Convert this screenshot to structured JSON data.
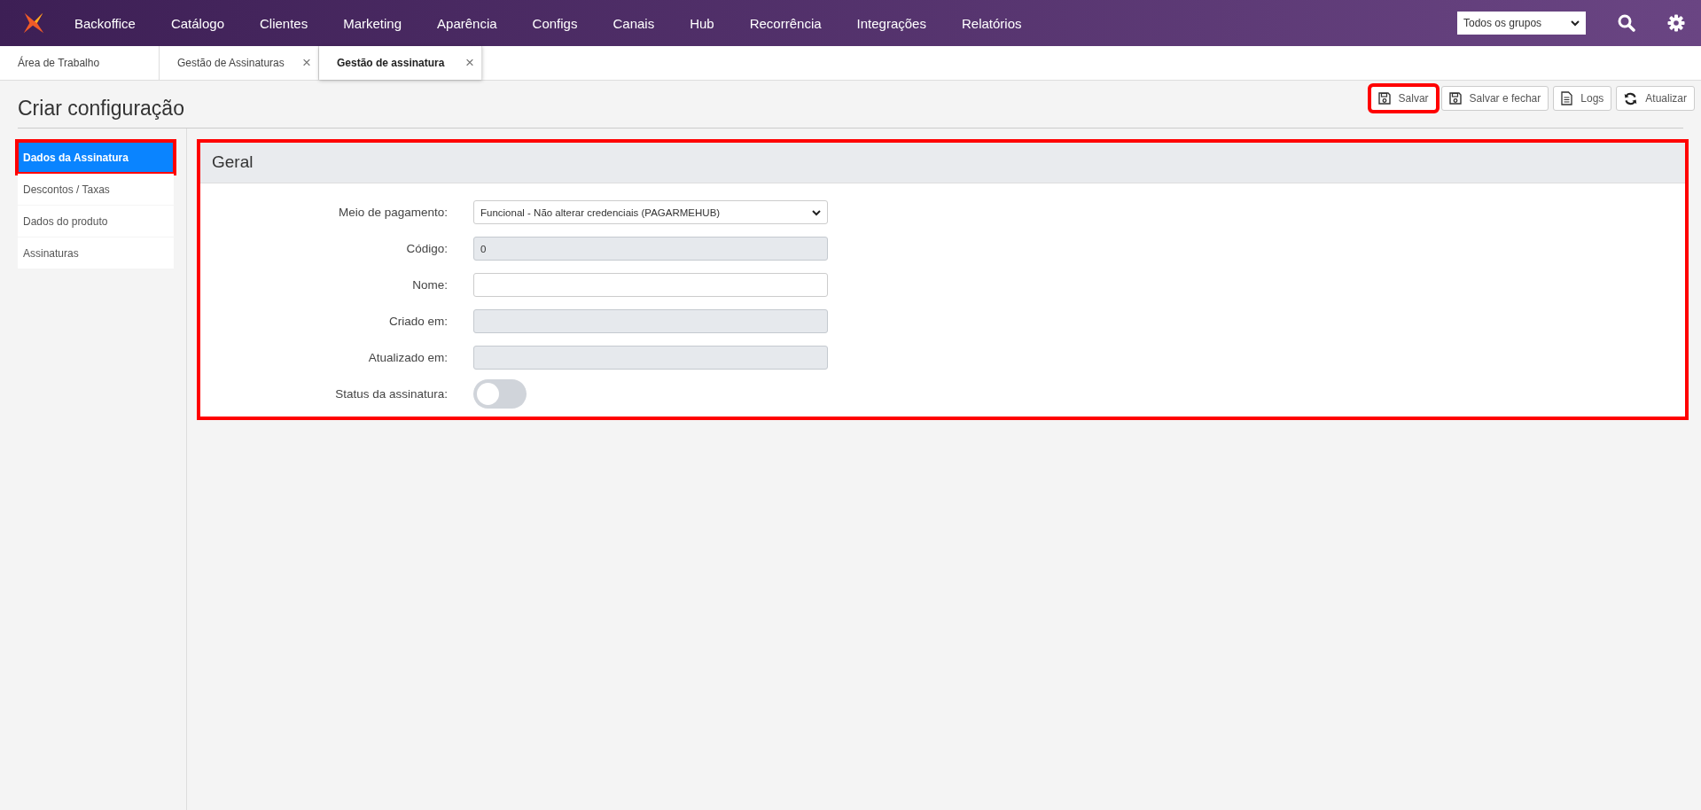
{
  "nav": {
    "items": [
      "Backoffice",
      "Catálogo",
      "Clientes",
      "Marketing",
      "Aparência",
      "Configs",
      "Canais",
      "Hub",
      "Recorrência",
      "Integrações",
      "Relatórios"
    ],
    "group_select": "Todos os grupos"
  },
  "tabs": [
    {
      "label": "Área de Trabalho",
      "selected": false
    },
    {
      "label": "Gestão de Assinaturas",
      "selected": false,
      "close": "×"
    },
    {
      "label": "Gestão de assinatura",
      "selected": true,
      "close": "×"
    }
  ],
  "page": {
    "title": "Criar configuração"
  },
  "toolbar": [
    {
      "kind": "save",
      "label": "Salvar",
      "highlighted": true
    },
    {
      "kind": "save",
      "label": "Salvar e fechar",
      "highlighted": false
    },
    {
      "kind": "doc",
      "label": "Logs",
      "highlighted": false
    },
    {
      "kind": "refresh",
      "label": "Atualizar",
      "highlighted": false
    }
  ],
  "sidebar": {
    "items": [
      {
        "label": "Dados da Assinatura",
        "selected": true,
        "highlighted": true
      },
      {
        "label": "Descontos / Taxas",
        "selected": false,
        "highlighted": false
      },
      {
        "label": "Dados do produto",
        "selected": false,
        "highlighted": false
      },
      {
        "label": "Assinaturas",
        "selected": false,
        "highlighted": false
      }
    ]
  },
  "panel": {
    "title": "Geral",
    "highlighted": true,
    "fields": [
      {
        "kind": "select",
        "label": "Meio de pagamento:",
        "value": "Funcional - Não alterar credenciais (PAGARMEHUB)"
      },
      {
        "kind": "text",
        "label": "Código:",
        "value": "0",
        "disabled": true
      },
      {
        "kind": "text",
        "label": "Nome:",
        "disabled": false
      },
      {
        "kind": "text",
        "label": "Criado em:",
        "disabled": true
      },
      {
        "kind": "text",
        "label": "Atualizado em:",
        "disabled": true
      },
      {
        "kind": "toggle",
        "label": "Status da assinatura:",
        "on": false
      }
    ]
  }
}
